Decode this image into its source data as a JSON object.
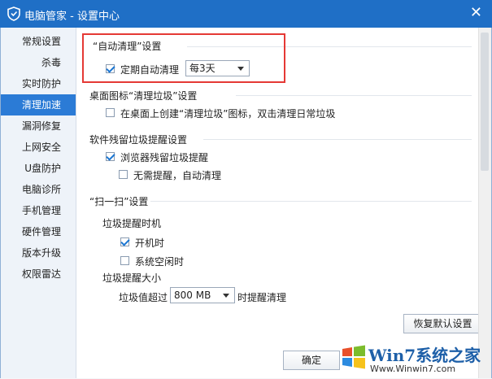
{
  "window": {
    "title": "电脑管家 - 设置中心",
    "close_label": "✕"
  },
  "sidebar": {
    "items": [
      {
        "label": "常规设置"
      },
      {
        "label": "杀毒"
      },
      {
        "label": "实时防护"
      },
      {
        "label": "清理加速"
      },
      {
        "label": "漏洞修复"
      },
      {
        "label": "上网安全"
      },
      {
        "label": "U盘防护"
      },
      {
        "label": "电脑诊所"
      },
      {
        "label": "手机管理"
      },
      {
        "label": "硬件管理"
      },
      {
        "label": "版本升级"
      },
      {
        "label": "权限雷达"
      }
    ]
  },
  "sections": {
    "auto_clean": {
      "title": "“自动清理”设置",
      "option_label": "定期自动清理",
      "option_checked": true,
      "interval_value": "每3天"
    },
    "desktop_icon": {
      "title": "桌面图标“清理垃圾”设置",
      "option_label": "在桌面上创建“清理垃圾”图标，双击清理日常垃圾",
      "option_checked": false
    },
    "residual": {
      "title": "软件残留垃圾提醒设置",
      "browser_label": "浏览器残留垃圾提醒",
      "browser_checked": true,
      "auto_label": "无需提醒，自动清理",
      "auto_checked": false
    },
    "scan": {
      "title": "“扫一扫”设置",
      "timing_title": "垃圾提醒时机",
      "boot_label": "开机时",
      "boot_checked": true,
      "idle_label": "系统空闲时",
      "idle_checked": false,
      "size_title": "垃圾提醒大小",
      "size_prefix": "垃圾值超过",
      "size_value": "800 MB",
      "size_suffix": "时提醒清理"
    }
  },
  "buttons": {
    "restore_default": "恢复默认设置",
    "ok": "确定"
  },
  "watermark": {
    "brand": "Win7系统之家",
    "url": "Www.Winwin7.com"
  },
  "colors": {
    "titlebar": "#1f6fc6",
    "active_item": "#2b7bd6",
    "highlight": "#e53935"
  }
}
